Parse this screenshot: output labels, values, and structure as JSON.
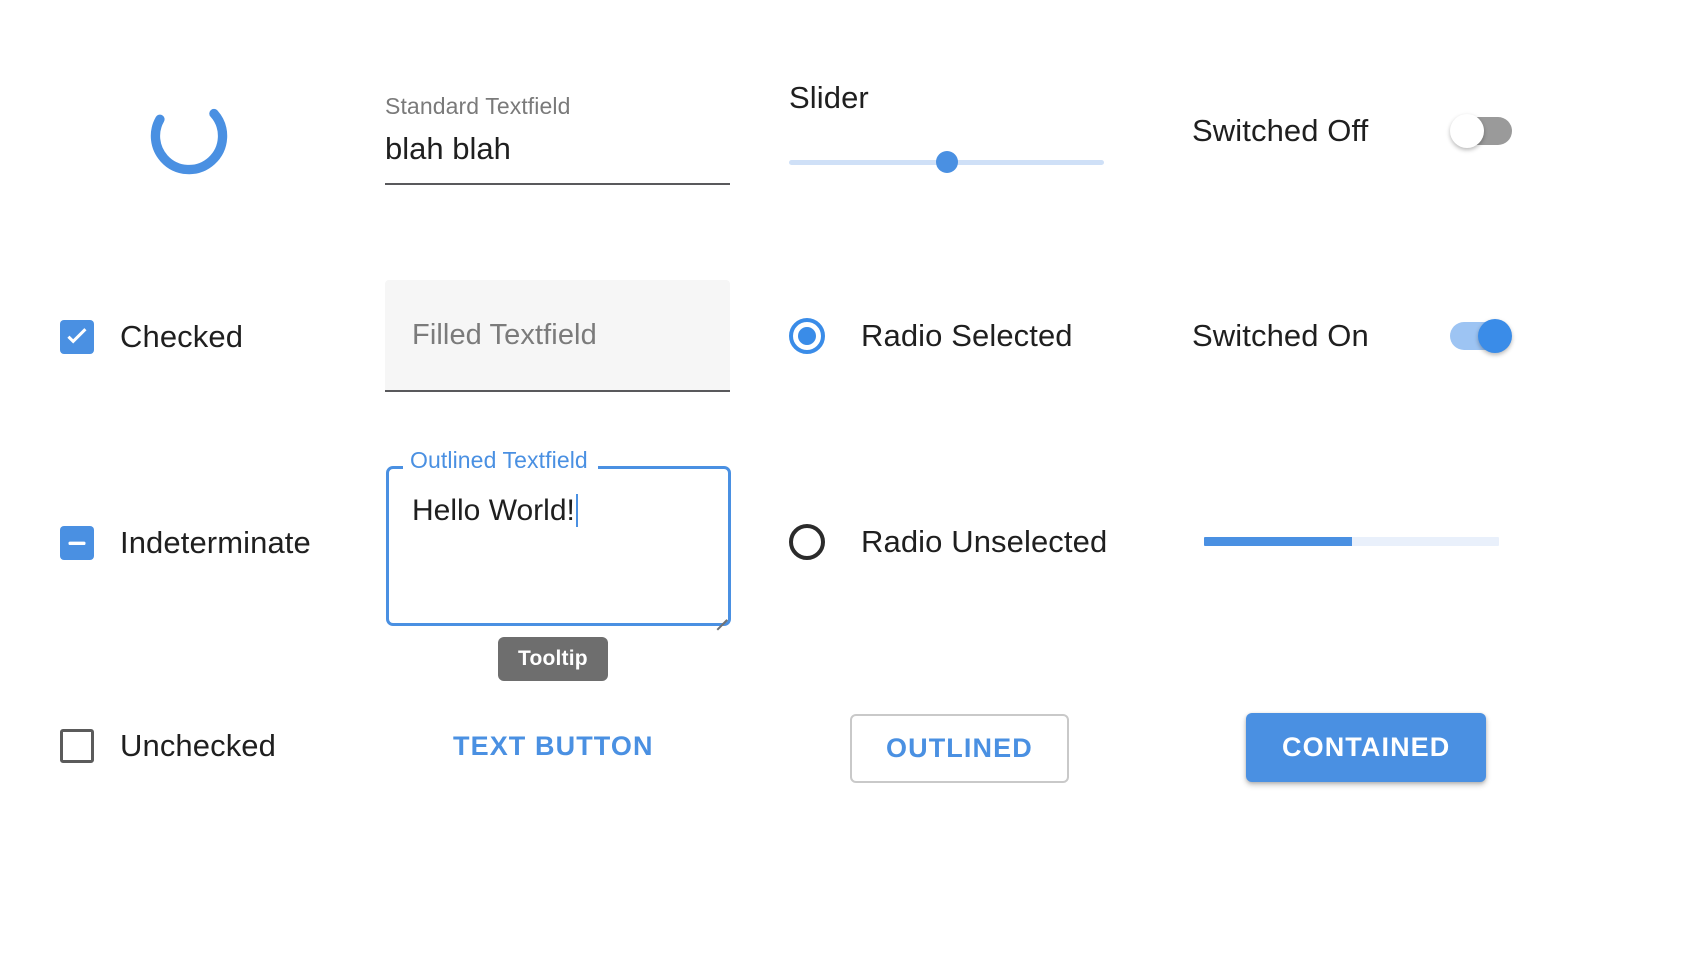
{
  "theme": {
    "accent": "#4a90e2",
    "accent_dark": "#3a8ce8",
    "track_off": "#9a9a9a",
    "track_on": "#9dc4f3",
    "text": "#1f1f1f",
    "muted": "#7a7a7a",
    "tooltip_bg": "#6e6e6e",
    "background": "#ffffff"
  },
  "progress_spinner": {
    "name": "circular-progress",
    "indeterminate": true,
    "arc_degrees": 250
  },
  "standard_textfield": {
    "label": "Standard Textfield",
    "value": "blah blah",
    "placeholder": "Standard Textfield"
  },
  "filled_textfield": {
    "label": "Filled Textfield",
    "value": "",
    "placeholder": "Filled Textfield"
  },
  "outlined_textfield": {
    "label": "Outlined Textfield",
    "value": "Hello World!",
    "placeholder": "Outlined Textfield",
    "focused": true,
    "multiline": true,
    "resizable": true
  },
  "tooltip": {
    "text": "Tooltip"
  },
  "checkboxes": [
    {
      "state": "checked",
      "label": "Checked",
      "icon": "check-icon"
    },
    {
      "state": "indeterminate",
      "label": "Indeterminate",
      "icon": "dash-icon"
    },
    {
      "state": "unchecked",
      "label": "Unchecked",
      "icon": ""
    }
  ],
  "slider": {
    "label": "Slider",
    "value": 50,
    "min": 0,
    "max": 100
  },
  "radios": [
    {
      "state": "selected",
      "label": "Radio Selected"
    },
    {
      "state": "unselected",
      "label": "Radio Unselected"
    }
  ],
  "switches": [
    {
      "state": "off",
      "label": "Switched Off"
    },
    {
      "state": "on",
      "label": "Switched On"
    }
  ],
  "progress_bar": {
    "value": 50,
    "min": 0,
    "max": 100
  },
  "buttons": {
    "text": "TEXT BUTTON",
    "outlined": "OUTLINED",
    "contained": "CONTAINED"
  }
}
